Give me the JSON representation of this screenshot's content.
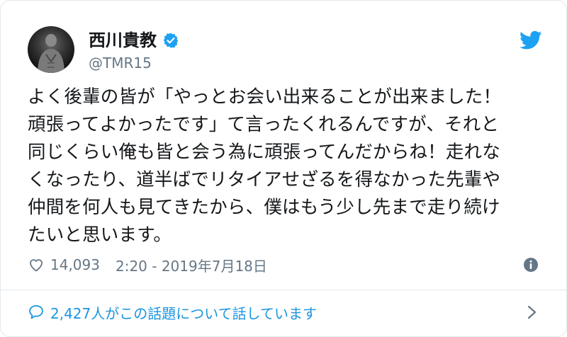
{
  "tweet": {
    "display_name": "西川貴教",
    "handle": "@TMR15",
    "text": "よく後輩の皆が「やっとお会い出来ることが出来ました！\n頑張ってよかったです」て言ったくれるんですが、それと\n同じくらい俺も皆と会う為に頑張ってんだからね！走れな\nくなったり、道半ばでリタイアせざるを得なかった先輩や\n仲間を何人も見てきたから、僕はもう少し先まで走り続け\nたいと思います。",
    "likes": "14,093",
    "timestamp": "2:20 - 2019年7月18日",
    "conversation": "2,427人がこの話題について話しています"
  },
  "icons": {
    "verified": "verified-badge-icon",
    "brand": "twitter-bird-icon",
    "heart": "heart-icon",
    "info": "info-icon",
    "conversation": "speech-bubble-icon",
    "chevron": "chevron-right-icon"
  },
  "colors": {
    "accent": "#1da1f2",
    "link": "#1b95e0",
    "secondary_text": "#657786",
    "border": "#e1e8ed"
  }
}
